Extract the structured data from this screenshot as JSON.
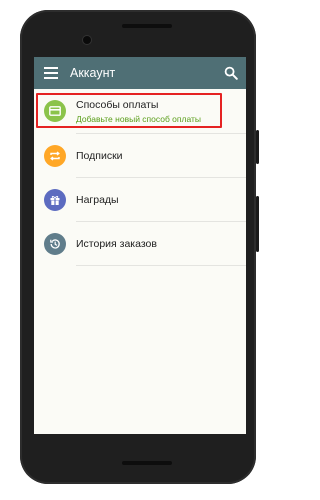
{
  "appbar": {
    "title": "Аккаунт",
    "menu_icon": "menu-icon",
    "search_icon": "search-icon",
    "color": "#4f6f75"
  },
  "items": [
    {
      "title": "Способы оплаты",
      "subtitle": "Добавьте новый способ оплаты",
      "icon": "credit-card-icon",
      "color": "#8bc34a",
      "highlighted": true
    },
    {
      "title": "Подписки",
      "icon": "repeat-icon",
      "color": "#ffa726"
    },
    {
      "title": "Награды",
      "icon": "gift-icon",
      "color": "#5c6bc0"
    },
    {
      "title": "История заказов",
      "icon": "history-icon",
      "color": "#607d8b"
    }
  ],
  "highlight_color": "#e52222"
}
